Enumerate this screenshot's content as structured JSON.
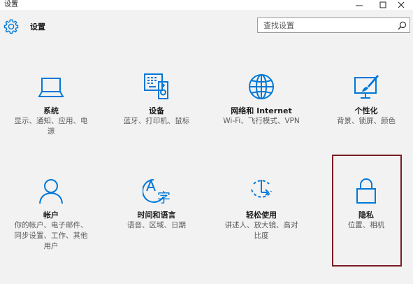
{
  "window": {
    "title": "设置",
    "controls": {
      "minimize_icon": "minimize-icon",
      "maximize_icon": "maximize-icon",
      "close_icon": "close-icon"
    }
  },
  "header": {
    "icon": "gear-icon",
    "title": "设置"
  },
  "search": {
    "placeholder": "查找设置",
    "icon": "search-icon"
  },
  "tiles": [
    {
      "icon": "laptop-icon",
      "label": "系统",
      "desc_lines": [
        "显示、通知、应用、电",
        "源"
      ]
    },
    {
      "icon": "devices-icon",
      "label": "设备",
      "desc_lines": [
        "蓝牙、打印机、鼠标"
      ]
    },
    {
      "icon": "globe-icon",
      "label": "网络和 Internet",
      "desc_lines": [
        "Wi-Fi、飞行模式、VPN"
      ]
    },
    {
      "icon": "personalization-icon",
      "label": "个性化",
      "desc_lines": [
        "背景、锁屏、颜色"
      ]
    },
    {
      "icon": "person-icon",
      "label": "帐户",
      "desc_lines": [
        "你的帐户、电子邮件、",
        "同步设置、工作、其他",
        "用户"
      ]
    },
    {
      "icon": "time-language-icon",
      "label": "时间和语言",
      "desc_lines": [
        "语音、区域、日期"
      ]
    },
    {
      "icon": "ease-of-access-icon",
      "label": "轻松使用",
      "desc_lines": [
        "讲述人、放大镜、高对",
        "比度"
      ]
    },
    {
      "icon": "lock-icon",
      "label": "隐私",
      "desc_lines": [
        "位置、相机"
      ]
    }
  ],
  "highlight": {
    "color": "#7a1c22",
    "target": "隐私"
  },
  "colors": {
    "accent": "#0078d7",
    "background": "#f2f2f2"
  }
}
